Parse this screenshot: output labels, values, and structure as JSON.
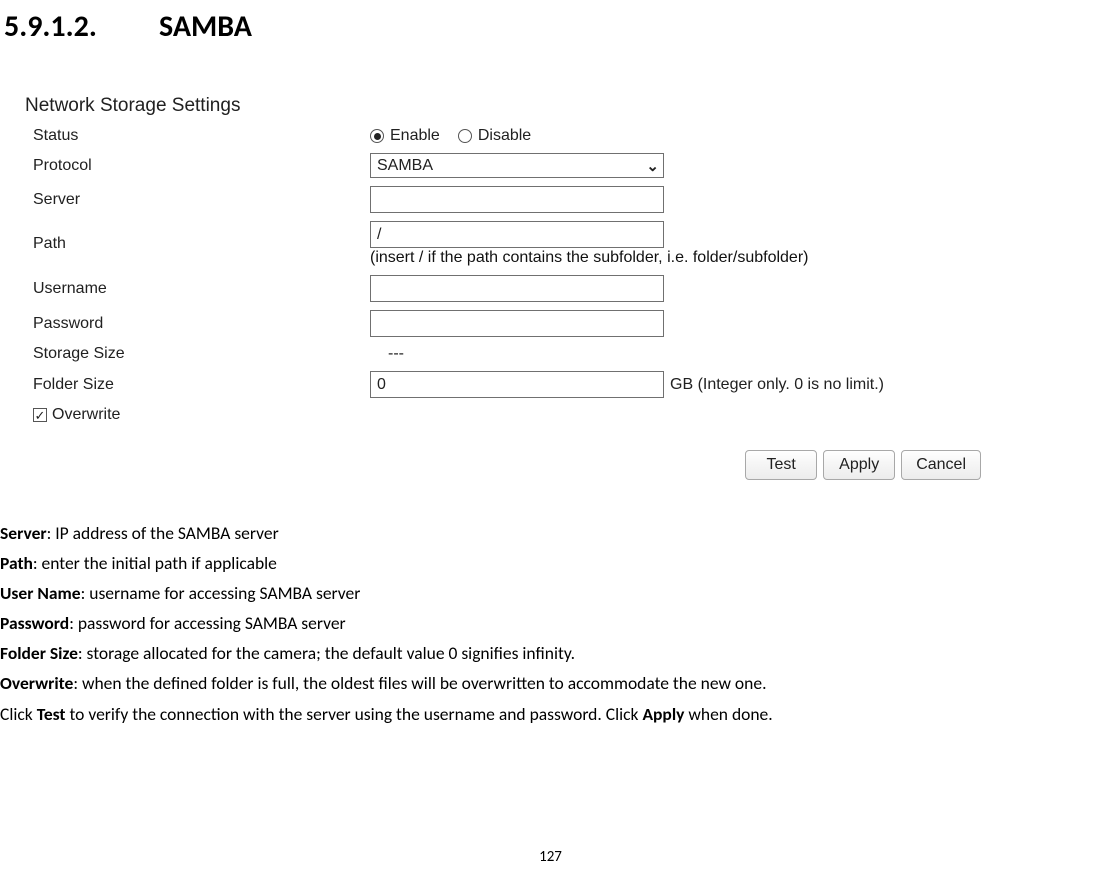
{
  "heading": {
    "number": "5.9.1.2.",
    "title": "SAMBA"
  },
  "panel": {
    "title": "Network Storage Settings",
    "status": {
      "label": "Status",
      "enable": "Enable",
      "disable": "Disable"
    },
    "protocol": {
      "label": "Protocol",
      "value": "SAMBA"
    },
    "server": {
      "label": "Server",
      "value": ""
    },
    "path": {
      "label": "Path",
      "value": "/",
      "hint": "(insert / if the path contains the subfolder, i.e. folder/subfolder)"
    },
    "username": {
      "label": "Username",
      "value": ""
    },
    "password": {
      "label": "Password",
      "value": ""
    },
    "storage_size": {
      "label": "Storage Size",
      "value": "---"
    },
    "folder_size": {
      "label": "Folder Size",
      "value": "0",
      "unit": "GB (Integer only. 0 is no limit.)"
    },
    "overwrite": {
      "label": "Overwrite",
      "checked": "✓"
    },
    "buttons": {
      "test": "Test",
      "apply": "Apply",
      "cancel": "Cancel"
    }
  },
  "desc": {
    "server_b": "Server",
    "server_t": ": IP address of the SAMBA server",
    "path_b": "Path",
    "path_t": ": enter the initial path if applicable",
    "user_b": "User Name",
    "user_t": ": username for accessing SAMBA server",
    "pass_b": "Password",
    "pass_t": ": password for accessing SAMBA server",
    "fsize_b": "Folder Size",
    "fsize_t": ": storage allocated for the camera; the default value 0 signifies infinity.",
    "ovr_b": "Overwrite",
    "ovr_t": ": when the defined folder is full, the oldest files will be overwritten to accommodate the new one.",
    "click1": "Click ",
    "test_b": "Test",
    "click1_t": " to verify the connection with the server using the username and password. Click ",
    "apply_b": "Apply",
    "click1_end": " when done."
  },
  "page_number": "127"
}
